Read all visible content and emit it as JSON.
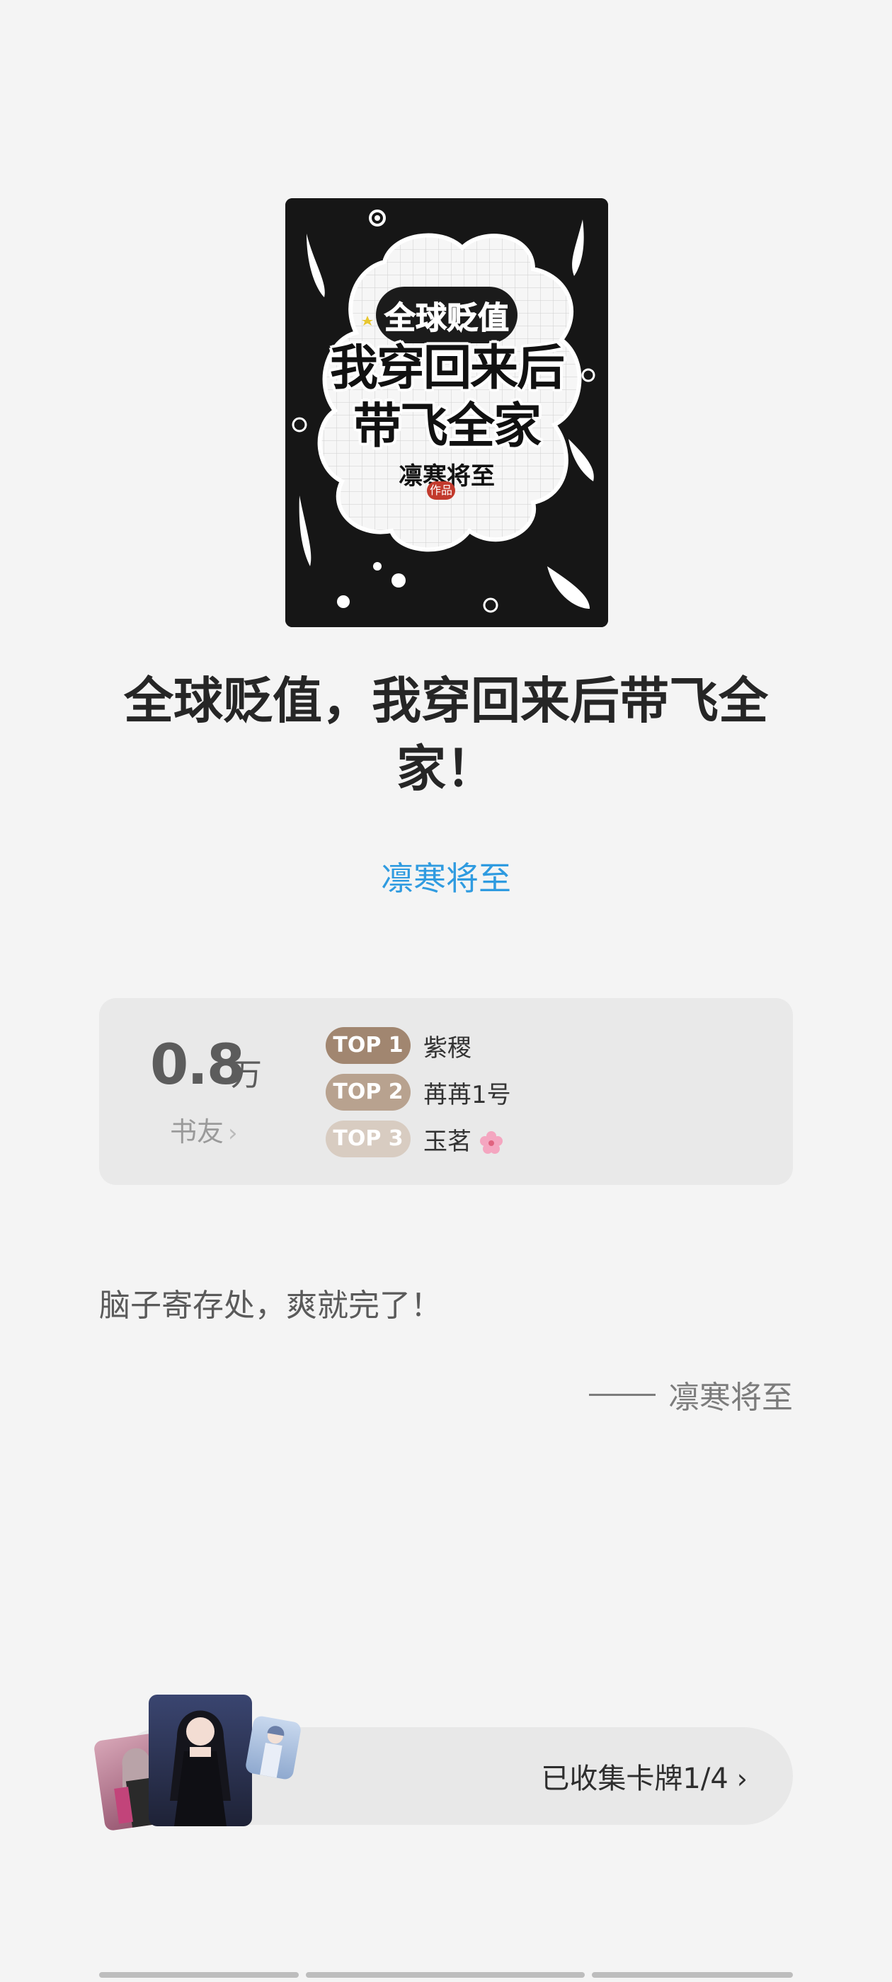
{
  "cover": {
    "subtitle": "全球贬值",
    "title_line1": "我穿回来后",
    "title_line2": "带飞全家",
    "author": "凛寒将至",
    "stamp": "作品"
  },
  "book": {
    "title": "全球贬值，我穿回来后带飞全家！",
    "author": "凛寒将至"
  },
  "stats": {
    "fans_number": "0.8",
    "fans_unit": "万",
    "fans_label": "书友",
    "ranks": [
      {
        "badge": "TOP 1",
        "name": "紫稷",
        "color": "#a18670"
      },
      {
        "badge": "TOP 2",
        "name": "苒苒1号",
        "color": "#b8a28f"
      },
      {
        "badge": "TOP 3",
        "name": "玉茗",
        "color": "#d8ccc1"
      }
    ]
  },
  "quote": {
    "text": "脑子寄存处，爽就完了！",
    "signature": "凛寒将至"
  },
  "collection": {
    "label": "已收集卡牌1/4"
  },
  "icons": {
    "chevron": "chevron-right-icon",
    "flower": "cherry-blossom-icon"
  }
}
